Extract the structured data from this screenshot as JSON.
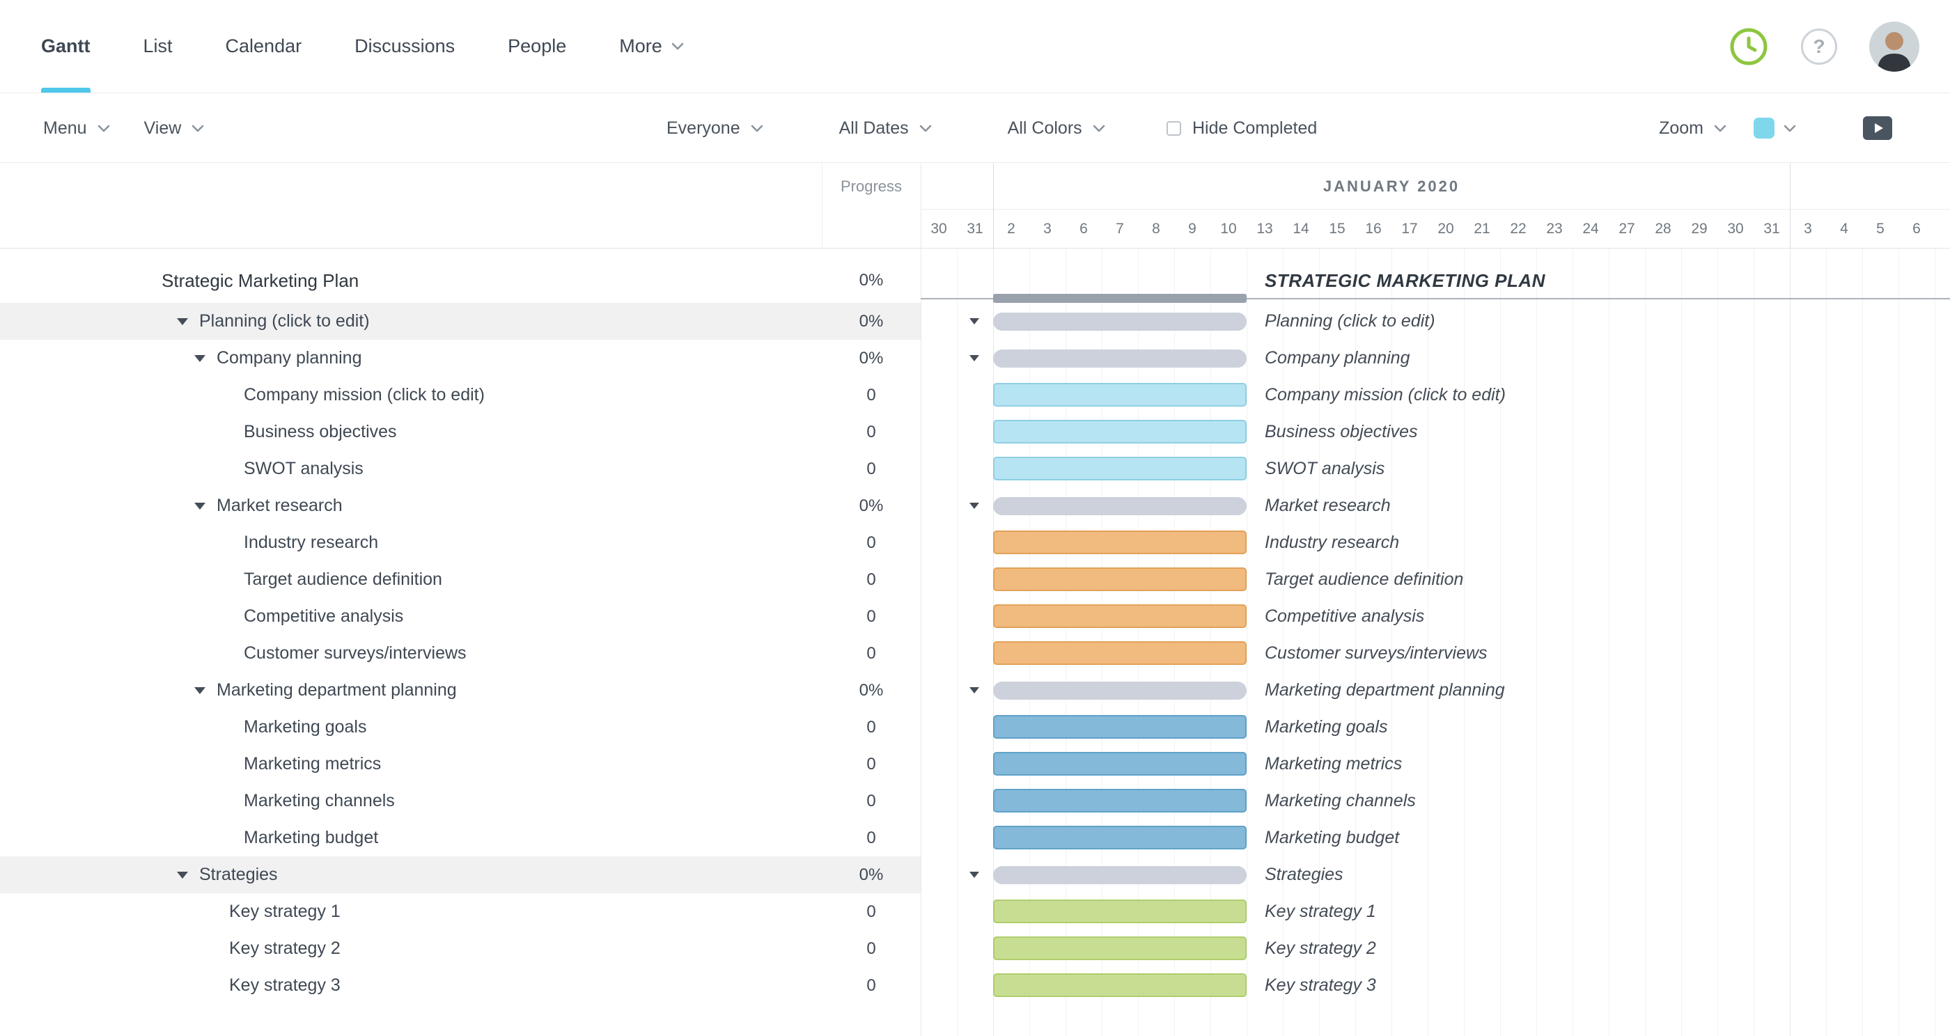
{
  "nav": {
    "tabs": [
      {
        "label": "Gantt",
        "active": true
      },
      {
        "label": "List",
        "active": false
      },
      {
        "label": "Calendar",
        "active": false
      },
      {
        "label": "Discussions",
        "active": false
      },
      {
        "label": "People",
        "active": false
      },
      {
        "label": "More",
        "active": false,
        "chevron": true
      }
    ],
    "icons": {
      "help_glyph": "?"
    }
  },
  "toolbar": {
    "menus": [
      {
        "label": "Menu"
      },
      {
        "label": "View"
      }
    ],
    "filters": [
      {
        "label": "Everyone"
      },
      {
        "label": "All Dates"
      },
      {
        "label": "All Colors"
      }
    ],
    "hide_completed": {
      "label": "Hide Completed",
      "checked": false
    },
    "zoom": {
      "label": "Zoom"
    }
  },
  "table": {
    "progress_header": "Progress"
  },
  "timeline": {
    "month_label": "JANUARY 2020",
    "days": [
      "30",
      "31",
      "2",
      "3",
      "6",
      "7",
      "8",
      "9",
      "10",
      "13",
      "14",
      "15",
      "16",
      "17",
      "20",
      "21",
      "22",
      "23",
      "24",
      "27",
      "28",
      "29",
      "30",
      "31",
      "3",
      "4",
      "5",
      "6"
    ],
    "month_start_col": 2,
    "month_end_col": 24,
    "bar_start_col": 2,
    "bar_end_col": 8
  },
  "colors": {
    "accent": "#4ec7ea",
    "group_bar": "#ccd1db",
    "project_bar": "#99a1ad",
    "palette": {
      "cyan": {
        "fill": "#b7e4f2",
        "border": "#8fcfe4"
      },
      "orange": {
        "fill": "#f1ba7e",
        "border": "#e2a258"
      },
      "blue": {
        "fill": "#84b9da",
        "border": "#5fa2c8"
      },
      "green": {
        "fill": "#c7de92",
        "border": "#afcc6c"
      }
    }
  },
  "rows": [
    {
      "type": "project",
      "name": "Strategic Marketing Plan",
      "progress": "0%",
      "chart_label": "STRATEGIC MARKETING PLAN"
    },
    {
      "type": "group",
      "level": 1,
      "name": "Planning (click to edit)",
      "progress": "0%",
      "highlighted": true
    },
    {
      "type": "group",
      "level": 2,
      "name": "Company planning",
      "progress": "0%"
    },
    {
      "type": "task",
      "level": 3,
      "name": "Company mission (click to edit)",
      "progress": "0",
      "color": "cyan"
    },
    {
      "type": "task",
      "level": 3,
      "name": "Business objectives",
      "progress": "0",
      "color": "cyan"
    },
    {
      "type": "task",
      "level": 3,
      "name": "SWOT analysis",
      "progress": "0",
      "color": "cyan"
    },
    {
      "type": "group",
      "level": 2,
      "name": "Market research",
      "progress": "0%"
    },
    {
      "type": "task",
      "level": 3,
      "name": "Industry research",
      "progress": "0",
      "color": "orange"
    },
    {
      "type": "task",
      "level": 3,
      "name": "Target audience definition",
      "progress": "0",
      "color": "orange"
    },
    {
      "type": "task",
      "level": 3,
      "name": "Competitive analysis",
      "progress": "0",
      "color": "orange"
    },
    {
      "type": "task",
      "level": 3,
      "name": "Customer surveys/interviews",
      "progress": "0",
      "color": "orange"
    },
    {
      "type": "group",
      "level": 2,
      "name": "Marketing department planning",
      "progress": "0%"
    },
    {
      "type": "task",
      "level": 3,
      "name": "Marketing goals",
      "progress": "0",
      "color": "blue"
    },
    {
      "type": "task",
      "level": 3,
      "name": "Marketing metrics",
      "progress": "0",
      "color": "blue"
    },
    {
      "type": "task",
      "level": 3,
      "name": "Marketing channels",
      "progress": "0",
      "color": "blue"
    },
    {
      "type": "task",
      "level": 3,
      "name": "Marketing budget",
      "progress": "0",
      "color": "blue"
    },
    {
      "type": "group",
      "level": 1,
      "name": "Strategies",
      "progress": "0%",
      "highlighted": true
    },
    {
      "type": "task",
      "level": 2,
      "name": "Key strategy 1",
      "progress": "0",
      "color": "green"
    },
    {
      "type": "task",
      "level": 2,
      "name": "Key strategy 2",
      "progress": "0",
      "color": "green"
    },
    {
      "type": "task",
      "level": 2,
      "name": "Key strategy 3",
      "progress": "0",
      "color": "green"
    }
  ]
}
